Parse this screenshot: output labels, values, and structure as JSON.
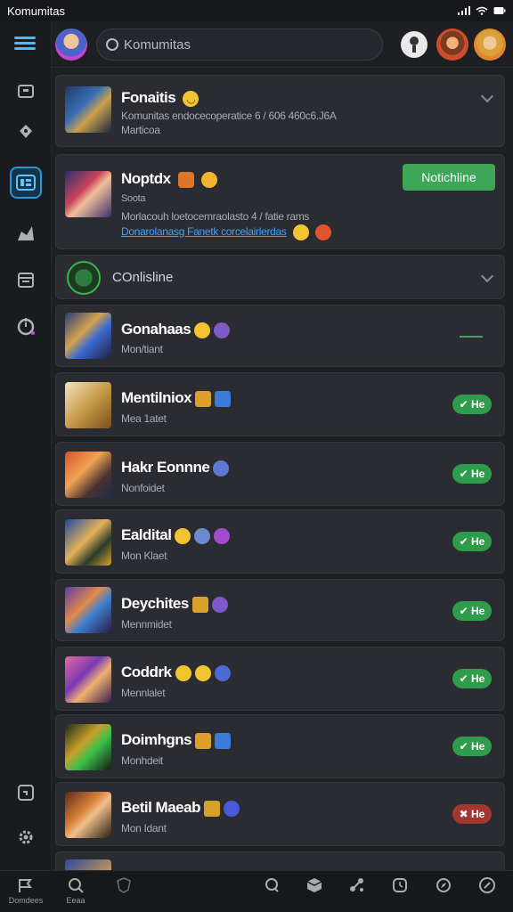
{
  "status": {
    "app_name": "Komumitas"
  },
  "search": {
    "placeholder": "Komumitas"
  },
  "communities": [
    {
      "title": "Fonaitis",
      "desc": "Komunitas endocecoperatice 6 / 606 460c6.J6A",
      "meta": "Marticoa"
    },
    {
      "title": "Noptdx",
      "desc": "Morlacouh loetocemraolasto 4 / fatie rams",
      "link": "Donarolanasg Fanetk corcelairlerdas",
      "button": "Notichline"
    }
  ],
  "section": {
    "label": "COnlisline"
  },
  "rows": [
    {
      "title": "Gonahaas",
      "sub": "Mon/tiant",
      "status": ""
    },
    {
      "title": "Mentilniox",
      "sub": "Mea 1atet",
      "status": "He"
    },
    {
      "title": "Hakr Eonnne",
      "sub": "Nonfoidet",
      "status": "He"
    },
    {
      "title": "Ealdital",
      "sub": "Mon Klaet",
      "status": "He"
    },
    {
      "title": "Deychites",
      "sub": "Mennmidet",
      "status": "He"
    },
    {
      "title": "Coddrk",
      "sub": "Mennlalet",
      "status": "He"
    },
    {
      "title": "Doimhgns",
      "sub": "Monhdeit",
      "status": "He"
    },
    {
      "title": "Betil Maeab",
      "sub": "Mon Idant",
      "status": "He",
      "status_color": "red"
    }
  ],
  "bottom_nav": [
    {
      "label": "Domdees",
      "icon": "flag-icon"
    },
    {
      "label": "Eeaa",
      "icon": "search-icon"
    },
    {
      "label": "",
      "icon": "shield-icon"
    },
    {
      "label": "",
      "icon": "chat-icon"
    },
    {
      "label": "",
      "icon": "cube-icon"
    },
    {
      "label": "",
      "icon": "share-icon"
    },
    {
      "label": "",
      "icon": "clock-icon"
    },
    {
      "label": "",
      "icon": "compass-icon"
    },
    {
      "label": "",
      "icon": "pen-icon"
    }
  ],
  "colors": {
    "accent": "#2c94d6",
    "green": "#3ea657",
    "red": "#a3362f",
    "bg": "#1e1f23",
    "card": "#2b2c31"
  }
}
